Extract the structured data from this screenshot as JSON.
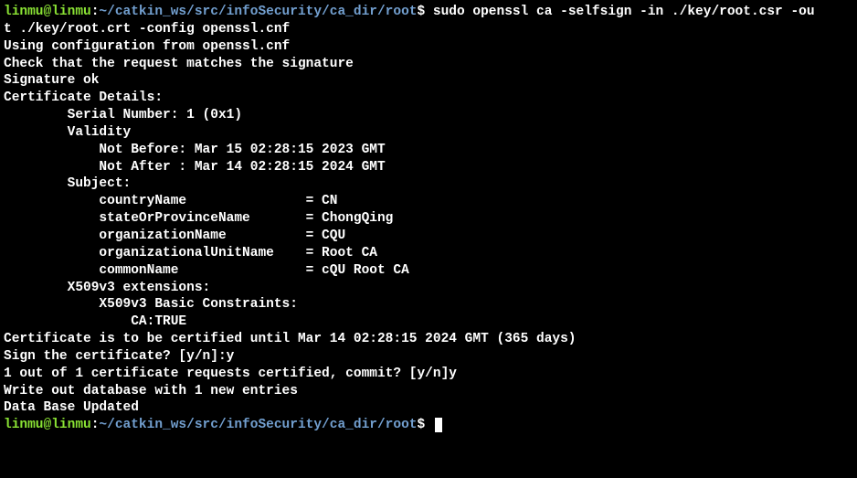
{
  "prompt1": {
    "user": "linmu@linmu",
    "colon": ":",
    "path": "~/catkin_ws/src/infoSecurity/ca_dir/root",
    "dollar": "$",
    "command_part1": " sudo openssl ca -selfsign -in ./key/root.csr -ou",
    "command_part2": "t ./key/root.crt -config openssl.cnf"
  },
  "output": {
    "l1": "Using configuration from openssl.cnf",
    "l2": "Check that the request matches the signature",
    "l3": "Signature ok",
    "l4": "Certificate Details:",
    "l5": "        Serial Number: 1 (0x1)",
    "l6": "        Validity",
    "l7": "            Not Before: Mar 15 02:28:15 2023 GMT",
    "l8": "            Not After : Mar 14 02:28:15 2024 GMT",
    "l9": "        Subject:",
    "l10": "            countryName               = CN",
    "l11": "            stateOrProvinceName       = ChongQing",
    "l12": "            organizationName          = CQU",
    "l13": "            organizationalUnitName    = Root CA",
    "l14": "            commonName                = cQU Root CA",
    "l15": "        X509v3 extensions:",
    "l16": "            X509v3 Basic Constraints:",
    "l17": "                CA:TRUE",
    "l18": "Certificate is to be certified until Mar 14 02:28:15 2024 GMT (365 days)",
    "l19": "Sign the certificate? [y/n]:y",
    "l20": "",
    "l21": "",
    "l22": "1 out of 1 certificate requests certified, commit? [y/n]y",
    "l23": "Write out database with 1 new entries",
    "l24": "Data Base Updated"
  },
  "prompt2": {
    "user": "linmu@linmu",
    "colon": ":",
    "path": "~/catkin_ws/src/infoSecurity/ca_dir/root",
    "dollar": "$"
  }
}
